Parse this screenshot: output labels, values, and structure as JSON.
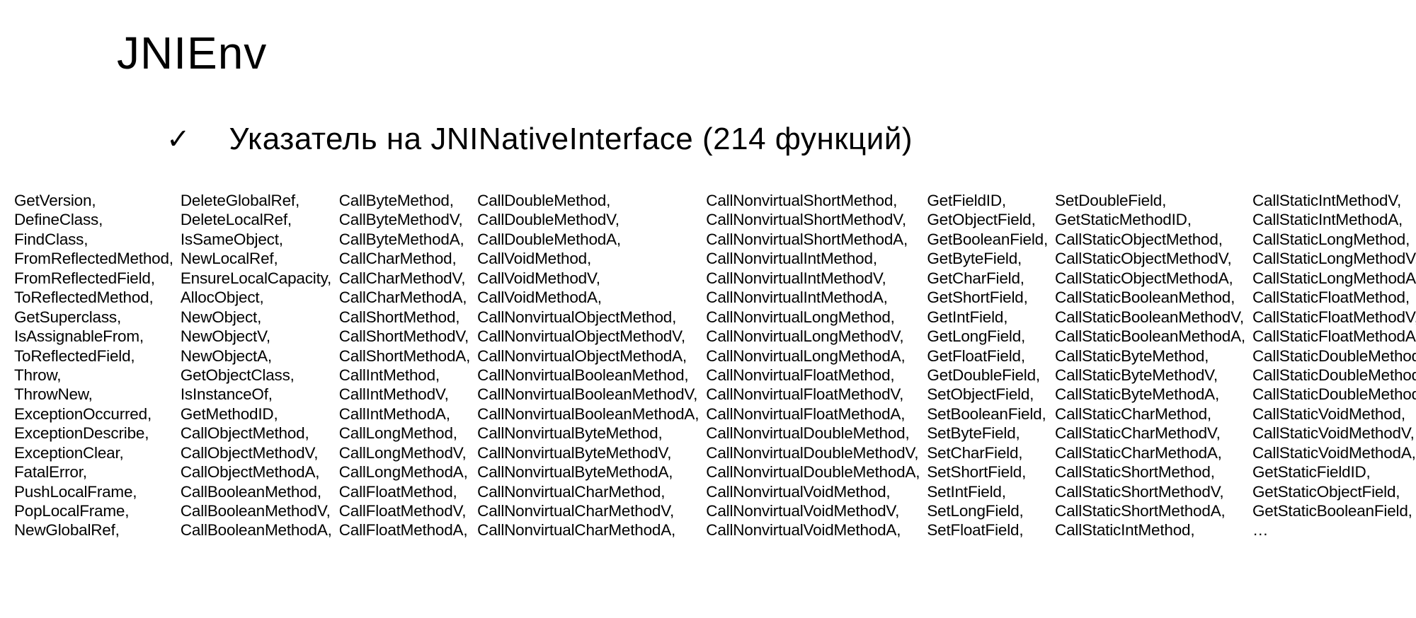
{
  "title": "JNIEnv",
  "checkmark": "✓",
  "subtitle": "Указатель на JNINativeInterface (214 функций)",
  "columns": [
    [
      "GetVersion,",
      "DefineClass,",
      "FindClass,",
      "FromReflectedMethod,",
      "FromReflectedField,",
      "ToReflectedMethod,",
      "GetSuperclass,",
      "IsAssignableFrom,",
      "ToReflectedField,",
      "Throw,",
      "ThrowNew,",
      "ExceptionOccurred,",
      "ExceptionDescribe,",
      "ExceptionClear,",
      "FatalError,",
      "PushLocalFrame,",
      "PopLocalFrame,",
      "NewGlobalRef,"
    ],
    [
      "DeleteGlobalRef,",
      "DeleteLocalRef,",
      "IsSameObject,",
      "NewLocalRef,",
      "EnsureLocalCapacity,",
      "AllocObject,",
      "NewObject,",
      "NewObjectV,",
      "NewObjectA,",
      "GetObjectClass,",
      "IsInstanceOf,",
      "GetMethodID,",
      "CallObjectMethod,",
      "CallObjectMethodV,",
      "CallObjectMethodA,",
      "CallBooleanMethod,",
      "CallBooleanMethodV,",
      "CallBooleanMethodA,"
    ],
    [
      "CallByteMethod,",
      "CallByteMethodV,",
      "CallByteMethodA,",
      "CallCharMethod,",
      "CallCharMethodV,",
      "CallCharMethodA,",
      "CallShortMethod,",
      "CallShortMethodV,",
      "CallShortMethodA,",
      "CallIntMethod,",
      "CallIntMethodV,",
      "CallIntMethodA,",
      "CallLongMethod,",
      "CallLongMethodV,",
      "CallLongMethodA,",
      "CallFloatMethod,",
      "CallFloatMethodV,",
      "CallFloatMethodA,"
    ],
    [
      "CallDoubleMethod,",
      "CallDoubleMethodV,",
      "CallDoubleMethodA,",
      "CallVoidMethod,",
      "CallVoidMethodV,",
      "CallVoidMethodA,",
      "CallNonvirtualObjectMethod,",
      "CallNonvirtualObjectMethodV,",
      "CallNonvirtualObjectMethodA,",
      "CallNonvirtualBooleanMethod,",
      "CallNonvirtualBooleanMethodV,",
      "CallNonvirtualBooleanMethodA,",
      "CallNonvirtualByteMethod,",
      "CallNonvirtualByteMethodV,",
      "CallNonvirtualByteMethodA,",
      "CallNonvirtualCharMethod,",
      "CallNonvirtualCharMethodV,",
      "CallNonvirtualCharMethodA,"
    ],
    [
      "CallNonvirtualShortMethod,",
      "CallNonvirtualShortMethodV,",
      "CallNonvirtualShortMethodA,",
      "CallNonvirtualIntMethod,",
      "CallNonvirtualIntMethodV,",
      "CallNonvirtualIntMethodA,",
      "CallNonvirtualLongMethod,",
      "CallNonvirtualLongMethodV,",
      "CallNonvirtualLongMethodA,",
      "CallNonvirtualFloatMethod,",
      "CallNonvirtualFloatMethodV,",
      "CallNonvirtualFloatMethodA,",
      "CallNonvirtualDoubleMethod,",
      "CallNonvirtualDoubleMethodV,",
      "CallNonvirtualDoubleMethodA,",
      "CallNonvirtualVoidMethod,",
      "CallNonvirtualVoidMethodV,",
      "CallNonvirtualVoidMethodA,"
    ],
    [
      "GetFieldID,",
      "GetObjectField,",
      "GetBooleanField,",
      "GetByteField,",
      "GetCharField,",
      "GetShortField,",
      "GetIntField,",
      "GetLongField,",
      "GetFloatField,",
      "GetDoubleField,",
      "SetObjectField,",
      "SetBooleanField,",
      "SetByteField,",
      "SetCharField,",
      "SetShortField,",
      "SetIntField,",
      "SetLongField,",
      "SetFloatField,"
    ],
    [
      "SetDoubleField,",
      "GetStaticMethodID,",
      "CallStaticObjectMethod,",
      "CallStaticObjectMethodV,",
      "CallStaticObjectMethodA,",
      "CallStaticBooleanMethod,",
      "CallStaticBooleanMethodV,",
      "CallStaticBooleanMethodA,",
      "CallStaticByteMethod,",
      "CallStaticByteMethodV,",
      "CallStaticByteMethodA,",
      "CallStaticCharMethod,",
      "CallStaticCharMethodV,",
      "CallStaticCharMethodA,",
      "CallStaticShortMethod,",
      "CallStaticShortMethodV,",
      "CallStaticShortMethodA,",
      "CallStaticIntMethod,"
    ],
    [
      "CallStaticIntMethodV,",
      "CallStaticIntMethodA,",
      "CallStaticLongMethod,",
      "CallStaticLongMethodV,",
      "CallStaticLongMethodA,",
      "CallStaticFloatMethod,",
      "CallStaticFloatMethodV,",
      "CallStaticFloatMethodA,",
      "CallStaticDoubleMethod,",
      "CallStaticDoubleMethodV,",
      "CallStaticDoubleMethodA,",
      "CallStaticVoidMethod,",
      "CallStaticVoidMethodV,",
      "CallStaticVoidMethodA,",
      "GetStaticFieldID,",
      "GetStaticObjectField,",
      "GetStaticBooleanField,",
      "…"
    ]
  ]
}
